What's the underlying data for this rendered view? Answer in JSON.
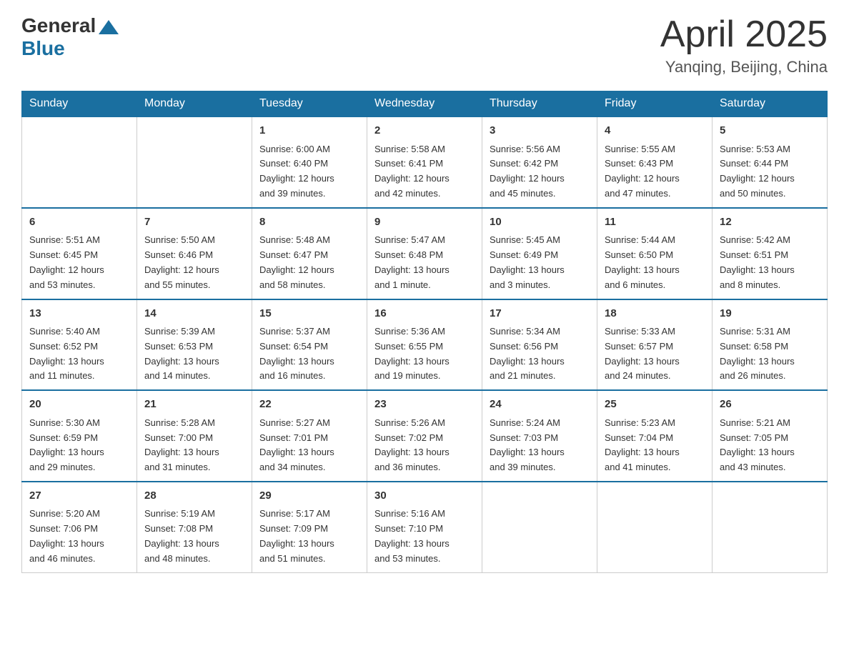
{
  "header": {
    "logo_general": "General",
    "logo_blue": "Blue",
    "month_title": "April 2025",
    "location": "Yanqing, Beijing, China"
  },
  "days_of_week": [
    "Sunday",
    "Monday",
    "Tuesday",
    "Wednesday",
    "Thursday",
    "Friday",
    "Saturday"
  ],
  "weeks": [
    [
      {
        "day": "",
        "info": ""
      },
      {
        "day": "",
        "info": ""
      },
      {
        "day": "1",
        "info": "Sunrise: 6:00 AM\nSunset: 6:40 PM\nDaylight: 12 hours\nand 39 minutes."
      },
      {
        "day": "2",
        "info": "Sunrise: 5:58 AM\nSunset: 6:41 PM\nDaylight: 12 hours\nand 42 minutes."
      },
      {
        "day": "3",
        "info": "Sunrise: 5:56 AM\nSunset: 6:42 PM\nDaylight: 12 hours\nand 45 minutes."
      },
      {
        "day": "4",
        "info": "Sunrise: 5:55 AM\nSunset: 6:43 PM\nDaylight: 12 hours\nand 47 minutes."
      },
      {
        "day": "5",
        "info": "Sunrise: 5:53 AM\nSunset: 6:44 PM\nDaylight: 12 hours\nand 50 minutes."
      }
    ],
    [
      {
        "day": "6",
        "info": "Sunrise: 5:51 AM\nSunset: 6:45 PM\nDaylight: 12 hours\nand 53 minutes."
      },
      {
        "day": "7",
        "info": "Sunrise: 5:50 AM\nSunset: 6:46 PM\nDaylight: 12 hours\nand 55 minutes."
      },
      {
        "day": "8",
        "info": "Sunrise: 5:48 AM\nSunset: 6:47 PM\nDaylight: 12 hours\nand 58 minutes."
      },
      {
        "day": "9",
        "info": "Sunrise: 5:47 AM\nSunset: 6:48 PM\nDaylight: 13 hours\nand 1 minute."
      },
      {
        "day": "10",
        "info": "Sunrise: 5:45 AM\nSunset: 6:49 PM\nDaylight: 13 hours\nand 3 minutes."
      },
      {
        "day": "11",
        "info": "Sunrise: 5:44 AM\nSunset: 6:50 PM\nDaylight: 13 hours\nand 6 minutes."
      },
      {
        "day": "12",
        "info": "Sunrise: 5:42 AM\nSunset: 6:51 PM\nDaylight: 13 hours\nand 8 minutes."
      }
    ],
    [
      {
        "day": "13",
        "info": "Sunrise: 5:40 AM\nSunset: 6:52 PM\nDaylight: 13 hours\nand 11 minutes."
      },
      {
        "day": "14",
        "info": "Sunrise: 5:39 AM\nSunset: 6:53 PM\nDaylight: 13 hours\nand 14 minutes."
      },
      {
        "day": "15",
        "info": "Sunrise: 5:37 AM\nSunset: 6:54 PM\nDaylight: 13 hours\nand 16 minutes."
      },
      {
        "day": "16",
        "info": "Sunrise: 5:36 AM\nSunset: 6:55 PM\nDaylight: 13 hours\nand 19 minutes."
      },
      {
        "day": "17",
        "info": "Sunrise: 5:34 AM\nSunset: 6:56 PM\nDaylight: 13 hours\nand 21 minutes."
      },
      {
        "day": "18",
        "info": "Sunrise: 5:33 AM\nSunset: 6:57 PM\nDaylight: 13 hours\nand 24 minutes."
      },
      {
        "day": "19",
        "info": "Sunrise: 5:31 AM\nSunset: 6:58 PM\nDaylight: 13 hours\nand 26 minutes."
      }
    ],
    [
      {
        "day": "20",
        "info": "Sunrise: 5:30 AM\nSunset: 6:59 PM\nDaylight: 13 hours\nand 29 minutes."
      },
      {
        "day": "21",
        "info": "Sunrise: 5:28 AM\nSunset: 7:00 PM\nDaylight: 13 hours\nand 31 minutes."
      },
      {
        "day": "22",
        "info": "Sunrise: 5:27 AM\nSunset: 7:01 PM\nDaylight: 13 hours\nand 34 minutes."
      },
      {
        "day": "23",
        "info": "Sunrise: 5:26 AM\nSunset: 7:02 PM\nDaylight: 13 hours\nand 36 minutes."
      },
      {
        "day": "24",
        "info": "Sunrise: 5:24 AM\nSunset: 7:03 PM\nDaylight: 13 hours\nand 39 minutes."
      },
      {
        "day": "25",
        "info": "Sunrise: 5:23 AM\nSunset: 7:04 PM\nDaylight: 13 hours\nand 41 minutes."
      },
      {
        "day": "26",
        "info": "Sunrise: 5:21 AM\nSunset: 7:05 PM\nDaylight: 13 hours\nand 43 minutes."
      }
    ],
    [
      {
        "day": "27",
        "info": "Sunrise: 5:20 AM\nSunset: 7:06 PM\nDaylight: 13 hours\nand 46 minutes."
      },
      {
        "day": "28",
        "info": "Sunrise: 5:19 AM\nSunset: 7:08 PM\nDaylight: 13 hours\nand 48 minutes."
      },
      {
        "day": "29",
        "info": "Sunrise: 5:17 AM\nSunset: 7:09 PM\nDaylight: 13 hours\nand 51 minutes."
      },
      {
        "day": "30",
        "info": "Sunrise: 5:16 AM\nSunset: 7:10 PM\nDaylight: 13 hours\nand 53 minutes."
      },
      {
        "day": "",
        "info": ""
      },
      {
        "day": "",
        "info": ""
      },
      {
        "day": "",
        "info": ""
      }
    ]
  ]
}
